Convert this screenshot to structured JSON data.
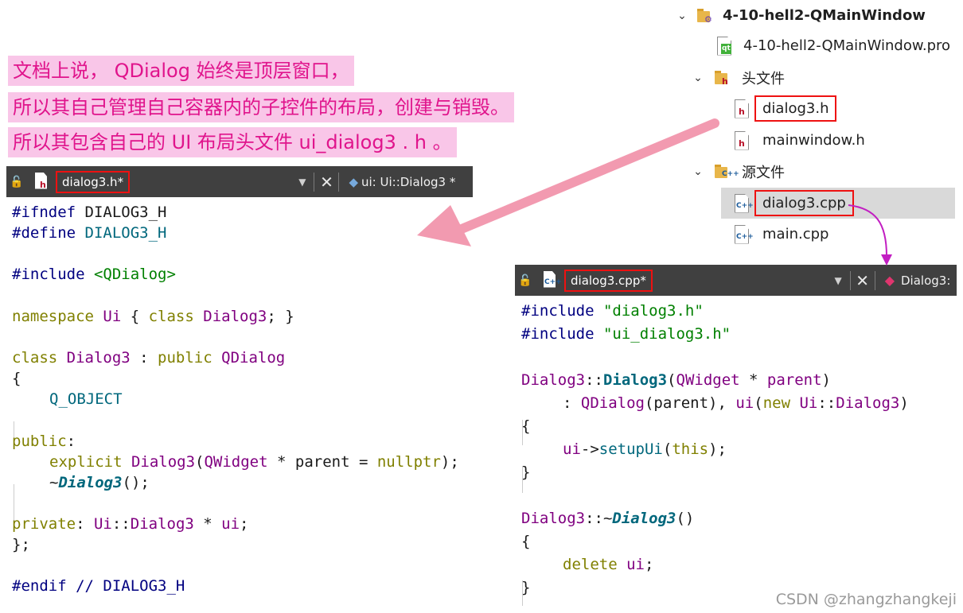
{
  "annotation": {
    "lines": [
      "文档上说， QDialog 始终是顶层窗口，",
      "所以其自己管理自己容器内的子控件的布局，创建与销毁。",
      "所以其包含自己的 UI 布局头文件 ui_dialog3 . h 。"
    ]
  },
  "project_tree": {
    "project_name": "4-10-hell2-QMainWindow",
    "pro_file": "4-10-hell2-QMainWindow.pro",
    "headers_folder": "头文件",
    "headers": [
      "dialog3.h",
      "mainwindow.h"
    ],
    "sources_folder": "源文件",
    "sources": [
      "dialog3.cpp",
      "main.cpp"
    ],
    "selected": "dialog3.cpp",
    "icon_badges": {
      "pro": "qt",
      "header": "h",
      "source": "C++"
    }
  },
  "header_editor": {
    "tab_title": "dialog3.h*",
    "secondary_tab": "ui: Ui::Dialog3 *",
    "code": {
      "l1_a": "#ifndef",
      "l1_b": " DIALOG3_H",
      "l2_a": "#define",
      "l2_b": " DIALOG3_H",
      "l3_a": "#include",
      "l3_b": " <QDialog>",
      "l4_a": "namespace",
      "l4_b": " Ui",
      "l4_c": " {",
      "l4_d": " class",
      "l4_e": " Dialog3",
      "l4_f": "; }",
      "l5_a": "class",
      "l5_b": " Dialog3",
      "l5_c": " :",
      "l5_d": " public",
      "l5_e": " QDialog",
      "l6": "{",
      "l7": "Q_OBJECT",
      "l8_a": "public",
      "l8_b": ":",
      "l9_a": "explicit",
      "l9_b": " Dialog3",
      "l9_c": "(",
      "l9_d": "QWidget",
      "l9_e": " * parent = ",
      "l9_f": "nullptr",
      "l9_g": ");",
      "l10_a": "~",
      "l10_b": "Dialog3",
      "l10_c": "();",
      "l11_a": "private",
      "l11_b": ": ",
      "l11_c": "Ui",
      "l11_d": "::",
      "l11_e": "Dialog3",
      "l11_f": " * ",
      "l11_g": "ui",
      "l11_h": ";",
      "l12": "};",
      "l13_a": "#endif",
      "l13_b": " // DIALOG3_H"
    }
  },
  "source_editor": {
    "tab_title": "dialog3.cpp*",
    "secondary_tab": "Dialog3:",
    "code": {
      "l1_a": "#include",
      "l1_b": " \"dialog3.h\"",
      "l2_a": "#include",
      "l2_b": " \"ui_dialog3.h\"",
      "l3_a": "Dialog3",
      "l3_b": "::",
      "l3_c": "Dialog3",
      "l3_d": "(",
      "l3_e": "QWidget",
      "l3_f": " * ",
      "l3_g": "parent",
      "l3_h": ")",
      "l4_a": ": ",
      "l4_b": "QDialog",
      "l4_c": "(parent), ",
      "l4_d": "ui",
      "l4_e": "(",
      "l4_f": "new",
      "l4_g": " Ui",
      "l4_h": "::",
      "l4_i": "Dialog3",
      "l4_j": ")",
      "l5": "{",
      "l6_a": "ui",
      "l6_b": "->",
      "l6_c": "setupUi",
      "l6_d": "(",
      "l6_e": "this",
      "l6_f": ");",
      "l7": "}",
      "l8_a": "Dialog3",
      "l8_b": "::~",
      "l8_c": "Dialog3",
      "l8_d": "()",
      "l9": "{",
      "l10_a": "delete",
      "l10_b": " ui",
      "l10_c": ";",
      "l11": "}"
    }
  },
  "watermark": "CSDN @zhangzhangkeji",
  "colors": {
    "annotation_bg": "#f9c6e8",
    "annotation_text": "#e0148c",
    "arrow": "#f29ab0",
    "connector": "#c21ec2",
    "highlight_box": "#ee1111",
    "tabbar": "#404040"
  }
}
